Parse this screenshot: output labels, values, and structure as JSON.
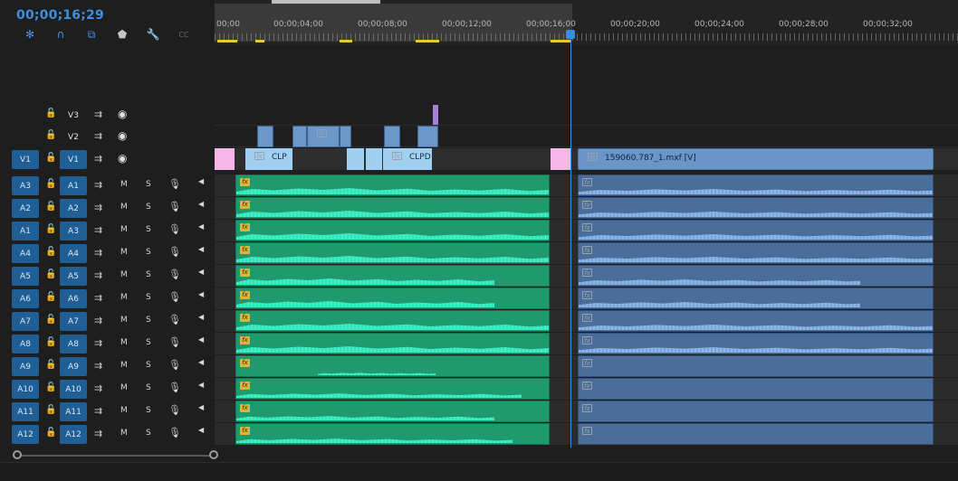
{
  "timecode": "00;00;16;29",
  "toolbar": {
    "items": [
      {
        "name": "snap-in-sequence-icon",
        "glyph": "✻"
      },
      {
        "name": "snap-magnet-icon",
        "glyph": "∩"
      },
      {
        "name": "linked-selection-icon",
        "glyph": "⧉"
      },
      {
        "name": "add-marker-icon",
        "glyph": "⬟"
      },
      {
        "name": "timeline-settings-wrench-icon",
        "glyph": "🔧"
      },
      {
        "name": "captions-cc-icon",
        "glyph": "CC"
      }
    ]
  },
  "ruler": {
    "labels": [
      "00;00",
      "00;00;04;00",
      "00;00;08;00",
      "00;00;12;00",
      "00;00;16;00",
      "00;00;20;00",
      "00;00;24;00",
      "00;00;28;00",
      "00;00;32;00"
    ]
  },
  "video_tracks": [
    {
      "name": "V3",
      "source": ""
    },
    {
      "name": "V2",
      "source": ""
    },
    {
      "name": "V1",
      "source": "V1"
    }
  ],
  "audio_tracks": [
    {
      "source": "A3",
      "name": "A1"
    },
    {
      "source": "A2",
      "name": "A2"
    },
    {
      "source": "A1",
      "name": "A3"
    },
    {
      "source": "A4",
      "name": "A4"
    },
    {
      "source": "A5",
      "name": "A5"
    },
    {
      "source": "A6",
      "name": "A6"
    },
    {
      "source": "A7",
      "name": "A7"
    },
    {
      "source": "A8",
      "name": "A8"
    },
    {
      "source": "A9",
      "name": "A9"
    },
    {
      "source": "A10",
      "name": "A10"
    },
    {
      "source": "A11",
      "name": "A11"
    },
    {
      "source": "A12",
      "name": "A12"
    }
  ],
  "track_controls": {
    "mute": "M",
    "solo": "S"
  },
  "clips": {
    "v1_clip_a": "CLP",
    "v1_clip_b": "CLPD",
    "v1_clip_c": "159060.787_1.mxf [V]"
  },
  "fx_label": "fx"
}
